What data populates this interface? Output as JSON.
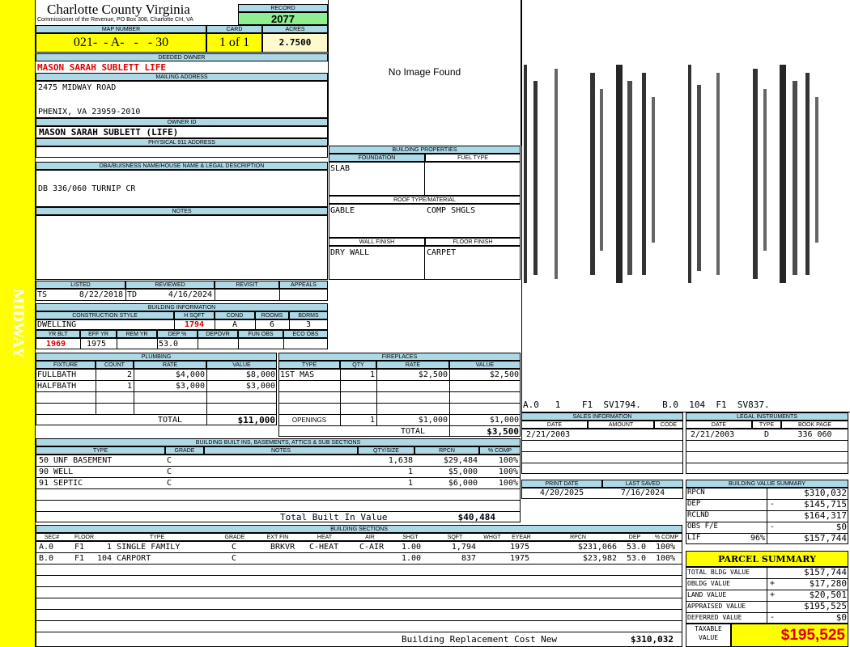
{
  "sidebar": {
    "text": "MIDWAY",
    "color": "#ffff00"
  },
  "header": {
    "county": "Charlotte County Virginia",
    "commissioner": "Commissioner of the Revenue, PO Box 308, Charlotte CH, VA"
  },
  "record": {
    "label": "RECORD",
    "value": "2077"
  },
  "map_number": {
    "label": "MAP NUMBER",
    "value": "021-  - A-   -   - 30"
  },
  "card": {
    "label": "CARD",
    "value": "1 of 1"
  },
  "acres": {
    "label": "ACRES",
    "value": "2.7500"
  },
  "deeded_owner": {
    "label": "DEEDED OWNER",
    "value": "MASON SARAH SUBLETT  LIFE"
  },
  "mailing": {
    "label": "MAILING ADDRESS",
    "line1": "2475 MIDWAY ROAD",
    "line2": "PHENIX, VA 23959-2010"
  },
  "owner_id": {
    "label": "OWNER ID",
    "value": "MASON SARAH SUBLETT (LIFE)"
  },
  "physical": {
    "label": "PHYSICAL 911 ADDRESS",
    "value": ""
  },
  "no_image": "No Image Found",
  "dba": {
    "label": "DBA/BUISNESS NAME/HOUSE NAME & LEGAL DESCRIPTION",
    "value": "DB 336/060 TURNIP CR"
  },
  "notes": {
    "label": "NOTES",
    "value": ""
  },
  "building_properties": {
    "label": "BUILDING PROPERTIES",
    "foundation_label": "FOUNDATION",
    "foundation": "SLAB",
    "fuel_label": "FUEL TYPE",
    "fuel": "",
    "roof_label": "ROOF TYPE/MATERIAL",
    "roof_type": "GABLE",
    "roof_material": "COMP SHGLS",
    "wall_label": "WALL FINISH",
    "wall": "DRY WALL",
    "floor_label": "FLOOR FINISH",
    "floor": "CARPET"
  },
  "sketch": {
    "caption": "A.0   1    F1  SV1794.    B.0  104  F1  SV837."
  },
  "listing": {
    "listed_label": "LISTED",
    "listed_by": "TS",
    "listed_date": "8/22/2018",
    "reviewed_label": "REVIEWED",
    "reviewed_by": "TD",
    "reviewed_date": "4/16/2024",
    "revisit_label": "REVISIT",
    "appeals_label": "APPEALS"
  },
  "building_info": {
    "label": "BUILDING INFORMATION",
    "style_label": "CONSTRUCTION STYLE",
    "style": "DWELLING",
    "hsqft_label": "H SQFT",
    "hsqft": "1794",
    "cond_label": "COND",
    "cond": "A",
    "rooms_label": "ROOMS",
    "rooms": "6",
    "bdrms_label": "BDRMS",
    "bdrms": "3",
    "yrblt_label": "YR BLT",
    "yrblt": "1969",
    "effyr_label": "EFF YR",
    "effyr": "1975",
    "remyr_label": "REM YR",
    "remyr": "",
    "dep_label": "DEP %",
    "dep": "53.0",
    "depovr_label": "DEPOVR",
    "funobs_label": "FUN OBS",
    "ecoobs_label": "ECO OBS"
  },
  "plumbing": {
    "label": "PLUMBING",
    "cols": [
      "FIXTURE",
      "COUNT",
      "RATE",
      "VALUE"
    ],
    "rows": [
      {
        "fixture": "FULLBATH",
        "count": "2",
        "rate": "$4,000",
        "value": "$8,000"
      },
      {
        "fixture": "HALFBATH",
        "count": "1",
        "rate": "$3,000",
        "value": "$3,000"
      }
    ],
    "total_label": "TOTAL",
    "total": "$11,000"
  },
  "fireplaces": {
    "label": "FIREPLACES",
    "cols": [
      "TYPE",
      "QTY",
      "RATE",
      "VALUE"
    ],
    "rows": [
      {
        "type": "1ST MAS",
        "qty": "1",
        "rate": "$2,500",
        "value": "$2,500"
      }
    ],
    "openings_label": "OPENINGS",
    "openings_qty": "1",
    "openings_rate": "$1,000",
    "openings_value": "$1,000",
    "total_label": "TOTAL",
    "total": "$3,500"
  },
  "sales": {
    "label": "SALES INFORMATION",
    "cols": [
      "DATE",
      "AMOUNT",
      "CODE"
    ],
    "date": "2/21/2003",
    "amount": "",
    "code": ""
  },
  "legal": {
    "label": "LEGAL INSTRUMENTS",
    "cols": [
      "DATE",
      "TYPE",
      "BOOK PAGE"
    ],
    "date": "2/21/2003",
    "type": "D",
    "bookpage": "336 060"
  },
  "builtins": {
    "label": "BUILDING BUILT INS, BASEMENTS, ATTICS & SUB SECTIONS",
    "cols": [
      "TYPE",
      "GRADE",
      "NOTES",
      "QTY/SIZE",
      "RPCN",
      "% COMP"
    ],
    "rows": [
      {
        "type": "50 UNF BASEMENT",
        "grade": "C",
        "qty": "1,638",
        "rpcn": "$29,484",
        "comp": "100%"
      },
      {
        "type": "90 WELL",
        "grade": "C",
        "qty": "1",
        "rpcn": "$5,000",
        "comp": "100%"
      },
      {
        "type": "91 SEPTIC",
        "grade": "C",
        "qty": "1",
        "rpcn": "$6,000",
        "comp": "100%"
      }
    ],
    "total_label": "Total Built In Value",
    "total": "$40,484"
  },
  "print": {
    "print_label": "PRINT DATE",
    "print_date": "4/20/2025",
    "saved_label": "LAST SAVED",
    "saved_date": "7/16/2024"
  },
  "value_summary": {
    "label": "BUILDING VALUE SUMMARY",
    "rows": [
      {
        "name": "RPCN",
        "pct": "",
        "sign": "",
        "value": "$310,032"
      },
      {
        "name": "DEP",
        "pct": "",
        "sign": "-",
        "value": "$145,715"
      },
      {
        "name": "RCLND",
        "pct": "",
        "sign": "",
        "value": "$164,317"
      },
      {
        "name": "OBS F/E",
        "pct": "",
        "sign": "-",
        "value": "$0"
      },
      {
        "name": "LIF",
        "pct": "96%",
        "sign": "",
        "value": "$157,744"
      }
    ]
  },
  "sections": {
    "label": "BUILDING SECTIONS",
    "cols": [
      "SEC#",
      "FLOOR",
      "TYPE",
      "GRADE",
      "EXT FIN",
      "HEAT",
      "AIR",
      "SHGT",
      "SQFT",
      "WHGT",
      "EYEAR",
      "RPCN",
      "DEP",
      "% COMP"
    ],
    "rows": [
      {
        "sec": "A.0",
        "floor": "F1",
        "type": "  1 SINGLE FAMILY",
        "grade": "C",
        "ext": "BRKVR",
        "heat": "C-HEAT",
        "air": "C-AIR",
        "shgt": "1.00",
        "sqft": "1,794",
        "whgt": "",
        "eyear": "1975",
        "rpcn": "$231,066",
        "dep": "53.0",
        "comp": "100%"
      },
      {
        "sec": "B.0",
        "floor": "F1",
        "type": "104 CARPORT",
        "grade": "C",
        "ext": "",
        "heat": "",
        "air": "",
        "shgt": "1.00",
        "sqft": "837",
        "whgt": "",
        "eyear": "1975",
        "rpcn": "$23,982",
        "dep": "53.0",
        "comp": "100%"
      }
    ],
    "total_label": "Building Replacement Cost New",
    "total": "$310,032"
  },
  "parcel": {
    "label": "PARCEL SUMMARY",
    "rows": [
      {
        "name": "TOTAL BLDG VALUE",
        "sign": "",
        "value": "$157,744"
      },
      {
        "name": "OBLDG VALUE",
        "sign": "+",
        "value": "$17,280"
      },
      {
        "name": "LAND VALUE",
        "sign": "+",
        "value": "$20,501"
      },
      {
        "name": "APPRAISED VALUE",
        "sign": "",
        "value": "$195,525"
      },
      {
        "name": "DEFERRED VALUE",
        "sign": "-",
        "value": "$0"
      }
    ],
    "taxable_label1": "TAXABLE",
    "taxable_label2": "VALUE",
    "taxable": "$195,525"
  }
}
